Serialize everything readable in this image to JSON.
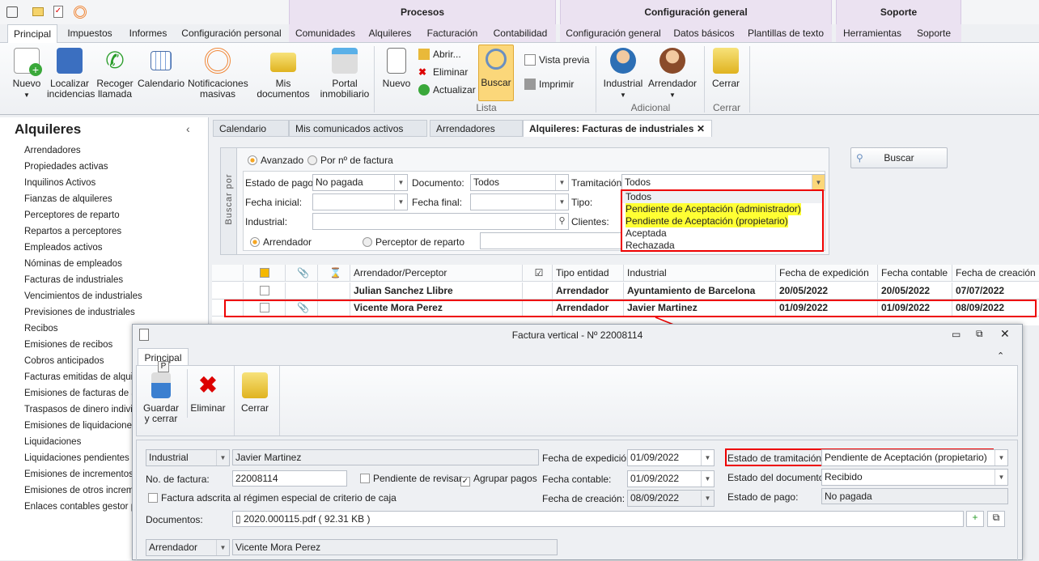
{
  "quick_access": {
    "icons": [
      "app-menu-icon",
      "mail-icon",
      "clipboard-check-icon",
      "broadcast-icon"
    ]
  },
  "context_groups": [
    "Procesos",
    "Configuración general",
    "Soporte"
  ],
  "ribbon_tabs": [
    "Principal",
    "Impuestos",
    "Informes",
    "Configuración personal",
    "Comunidades",
    "Alquileres",
    "Facturación",
    "Contabilidad",
    "Configuración general",
    "Datos básicos",
    "Plantillas de texto",
    "Herramientas",
    "Soporte"
  ],
  "ribbon": {
    "main_buttons": [
      {
        "label": "Nuevo",
        "icon": "new-document-icon"
      },
      {
        "label": "Localizar incidencias",
        "icon": "file-cabinet-icon"
      },
      {
        "label": "Recoger llamada",
        "icon": "phone-icon"
      },
      {
        "label": "Calendario",
        "icon": "calendar-icon"
      },
      {
        "label": "Notificaciones masivas",
        "icon": "broadcast-icon"
      },
      {
        "label": "Mis documentos",
        "icon": "folder-icon"
      },
      {
        "label": "Portal inmobiliario",
        "icon": "portal-icon"
      }
    ],
    "lista": {
      "nuevo": "Nuevo",
      "abrir": "Abrir...",
      "eliminar": "Eliminar",
      "actualizar": "Actualizar",
      "buscar": "Buscar",
      "vista_previa": "Vista previa",
      "imprimir": "Imprimir",
      "group": "Lista"
    },
    "adicional": {
      "industrial": "Industrial",
      "arrendador": "Arrendador",
      "group": "Adicional"
    },
    "cerrar": {
      "label": "Cerrar",
      "group": "Cerrar"
    }
  },
  "sidebar": {
    "title": "Alquileres",
    "items": [
      "Arrendadores",
      "Propiedades activas",
      "Inquilinos Activos",
      "Fianzas de alquileres",
      "Perceptores de reparto",
      "Repartos a perceptores",
      "Empleados activos",
      "Nóminas de empleados",
      "Facturas de industriales",
      "Vencimientos de industriales",
      "Previsiones de industriales",
      "Recibos",
      "Emisiones de recibos",
      "Cobros anticipados",
      "Facturas emitidas de alquileres",
      "Emisiones de facturas de alquileres",
      "Traspasos de dinero individuales",
      "Emisiones de liquidaciones",
      "Liquidaciones",
      "Liquidaciones pendientes de",
      "Emisiones de incrementos d",
      "Emisiones de otros increme",
      "Enlaces contables gestor pa"
    ]
  },
  "doc_tabs": [
    "Calendario",
    "Mis comunicados activos",
    "Arrendadores",
    "Alquileres: Facturas de industriales"
  ],
  "search": {
    "side_label": "Buscar por",
    "mode_advanced": "Avanzado",
    "mode_number": "Por nº de factura",
    "estado_pago_label": "Estado de pago:",
    "estado_pago": "No pagada",
    "documento_label": "Documento:",
    "documento": "Todos",
    "tramitacion_label": "Tramitación:",
    "tramitacion": "Todos",
    "fecha_inicial_label": "Fecha inicial:",
    "fecha_final_label": "Fecha final:",
    "tipo_label": "Tipo:",
    "industrial_label": "Industrial:",
    "clientes_label": "Clientes:",
    "radio_arrendador": "Arrendador",
    "radio_perceptor": "Perceptor de reparto",
    "button": "Buscar",
    "dropdown_options": [
      "Todos",
      "Pendiente de Aceptación (administrador)",
      "Pendiente de Aceptación (propietario)",
      "Aceptada",
      "Rechazada"
    ]
  },
  "grid": {
    "headers": [
      "Arrendador/Perceptor",
      "Tipo entidad",
      "Industrial",
      "Fecha de expedición",
      "Fecha contable",
      "Fecha de creación"
    ],
    "rows": [
      [
        "Julian Sanchez Llibre",
        "Arrendador",
        "Ayuntamiento de Barcelona",
        "20/05/2022",
        "20/05/2022",
        "07/07/2022"
      ],
      [
        "Vicente Mora Perez",
        "Arrendador",
        "Javier Martinez",
        "01/09/2022",
        "01/09/2022",
        "08/09/2022"
      ]
    ]
  },
  "dialog": {
    "title": "Factura vertical - Nº 22008114",
    "tab": "Principal",
    "key_tip": "P",
    "guardar": "Guardar y cerrar",
    "eliminar": "Eliminar",
    "cerrar": "Cerrar",
    "tipo1": "Industrial",
    "nombre1": "Javier Martinez",
    "no_factura_label": "No. de factura:",
    "no_factura": "22008114",
    "pendiente_revisar": "Pendiente de revisar",
    "agrupar_pagos": "Agrupar pagos",
    "regimen": "Factura adscrita al régimen especial de criterio de caja",
    "fecha_exp_label": "Fecha de expedición:",
    "fecha_exp": "01/09/2022",
    "fecha_cont_label": "Fecha contable:",
    "fecha_cont": "01/09/2022",
    "fecha_crea_label": "Fecha de creación:",
    "fecha_crea": "08/09/2022",
    "estado_tram_label": "Estado de tramitación:",
    "estado_tram": "Pendiente de Aceptación (propietario)",
    "estado_doc_label": "Estado del documento:",
    "estado_doc": "Recibido",
    "estado_pago_label": "Estado de pago:",
    "estado_pago": "No pagada",
    "documentos_label": "Documentos:",
    "documento": "2020.000115.pdf ( 92.31 KB )",
    "tipo2": "Arrendador",
    "nombre2": "Vicente Mora Perez"
  },
  "colors": {
    "highlight": "#ffff33",
    "annotation": "#e00000",
    "context_tab": "#ebe2f1"
  }
}
